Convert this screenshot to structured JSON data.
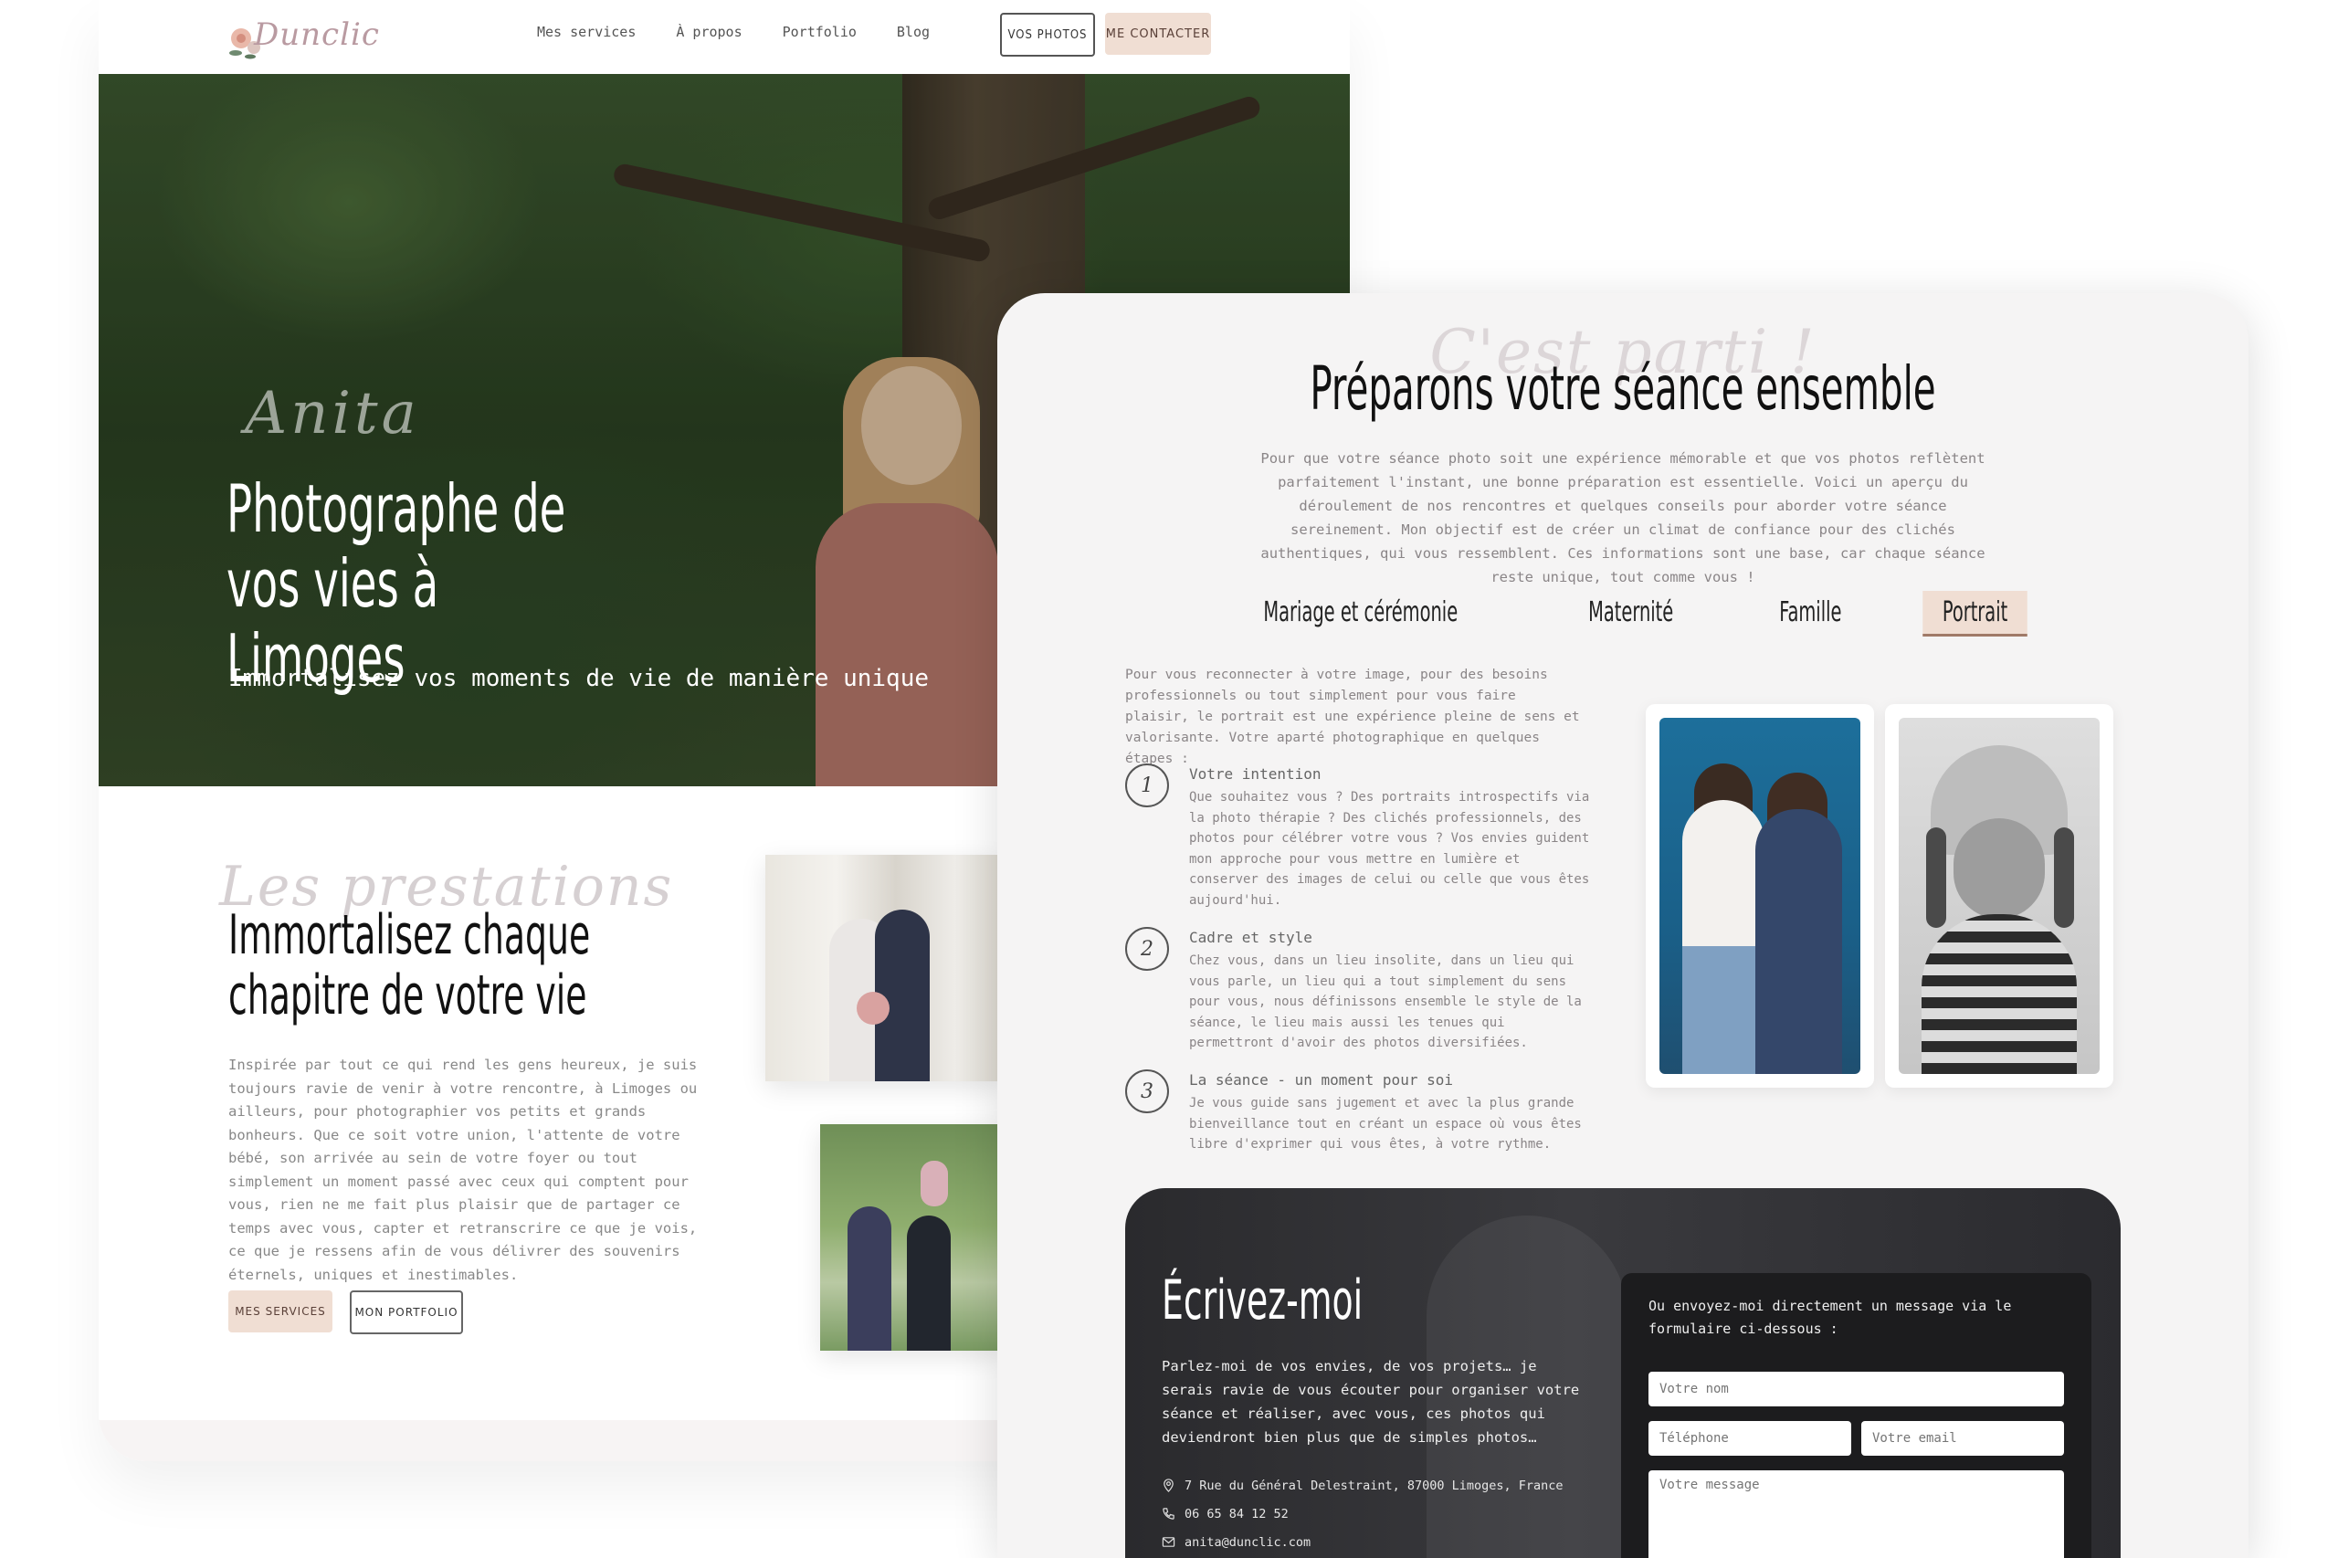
{
  "nav": {
    "logo_text": "Dunclic",
    "links": [
      "Mes services",
      "À propos",
      "Portfolio",
      "Blog"
    ],
    "btn_photos": "VOS PHOTOS",
    "btn_contact": "ME CONTACTER"
  },
  "hero": {
    "script": "Anita",
    "title": "Photographe de vos vies à Limoges",
    "subtitle": "Immortalisez vos moments de vie de manière unique"
  },
  "prestations": {
    "script": "Les prestations",
    "title": "Immortalisez chaque chapitre de votre vie",
    "text": "Inspirée par tout ce qui rend les gens heureux, je suis toujours ravie de venir à votre rencontre, à Limoges ou ailleurs, pour photographier vos petits et grands bonheurs. Que ce soit votre union, l'attente de votre bébé, son arrivée au sein de votre foyer ou tout simplement un moment passé avec ceux qui comptent pour vous, rien ne me fait plus plaisir que de partager ce temps avec vous, capter et retranscrire ce que je vois, ce que je ressens afin de vous délivrer des souvenirs éternels, uniques et inestimables.",
    "btn_services": "MES SERVICES",
    "btn_portfolio": "MON PORTFOLIO"
  },
  "seance": {
    "script": "C'est parti !",
    "title": "Préparons votre séance ensemble",
    "intro": "Pour que votre séance photo soit une expérience mémorable et que vos photos reflètent parfaitement l'instant, une bonne préparation est essentielle. Voici un aperçu du déroulement de nos rencontres et quelques conseils pour aborder votre séance sereinement. Mon objectif est de créer un climat de confiance pour des clichés authentiques, qui vous ressemblent. Ces informations sont une base, car chaque séance reste unique, tout comme vous !",
    "tabs": [
      "Mariage et cérémonie",
      "Maternité",
      "Famille",
      "Portrait"
    ],
    "active_tab": "Portrait",
    "lead": "Pour vous reconnecter à votre image, pour des besoins professionnels ou tout simplement pour vous faire plaisir, le portrait est une expérience pleine de sens et valorisante. Votre aparté photographique en quelques étapes :",
    "steps": [
      {
        "num": "1",
        "title": "Votre intention",
        "text": "Que souhaitez vous ? Des portraits introspectifs via la photo thérapie ? Des clichés professionnels, des photos pour célébrer votre vous ? Vos envies guident mon approche pour vous mettre en lumière et conserver des images de celui ou celle que vous êtes aujourd'hui."
      },
      {
        "num": "2",
        "title": "Cadre et style",
        "text": "Chez vous, dans un lieu insolite, dans un lieu qui vous parle, un lieu qui a tout simplement du sens pour vous, nous définissons ensemble le style de la séance, le lieu mais aussi les tenues qui permettront d'avoir des photos diversifiées."
      },
      {
        "num": "3",
        "title": "La séance - un moment pour soi",
        "text": "Je vous guide sans jugement et avec la plus grande bienveillance tout en créant un espace où vous êtes libre d'exprimer qui vous êtes, à votre rythme."
      }
    ]
  },
  "contact": {
    "title": "Écrivez-moi",
    "text": "Parlez-moi de vos envies, de vos projets… je serais ravie de vous écouter pour organiser votre séance et réaliser, avec vous, ces photos qui deviendront bien plus que de simples photos…",
    "address": "7 Rue du Général Delestraint, 87000 Limoges, France",
    "phone": "06 65 84 12 52",
    "email": "anita@dunclic.com",
    "form_lead": "Ou envoyez-moi directement un message via le formulaire ci-dessous :",
    "placeholder_name": "Votre nom",
    "placeholder_phone": "Téléphone",
    "placeholder_email": "Votre email",
    "placeholder_message": "Votre message"
  },
  "colors": {
    "accent": "#f0ded3",
    "dark_panel": "#2c2c30",
    "text_muted": "#8a8587"
  }
}
